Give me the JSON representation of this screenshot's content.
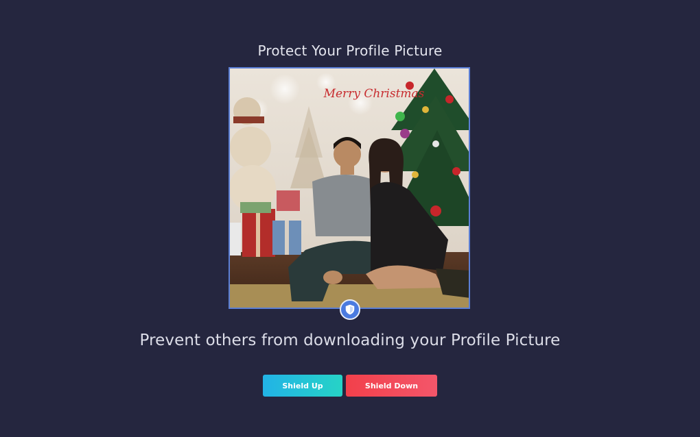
{
  "header": {
    "title": "Protect Your Profile Picture"
  },
  "photo": {
    "sign_text": "Merry Christmas"
  },
  "main": {
    "tagline": "Prevent others from downloading your Profile Picture"
  },
  "actions": {
    "shield_up_label": "Shield Up",
    "shield_down_label": "Shield Down"
  },
  "colors": {
    "background": "#25263f",
    "frame_border": "#5b7fd6",
    "shield_badge": "#4b7be0",
    "shield_up_start": "#22b3e6",
    "shield_up_end": "#26d3c6",
    "shield_down_start": "#f2404b",
    "shield_down_end": "#f3566a"
  },
  "icons": {
    "badge": "shield-icon"
  }
}
